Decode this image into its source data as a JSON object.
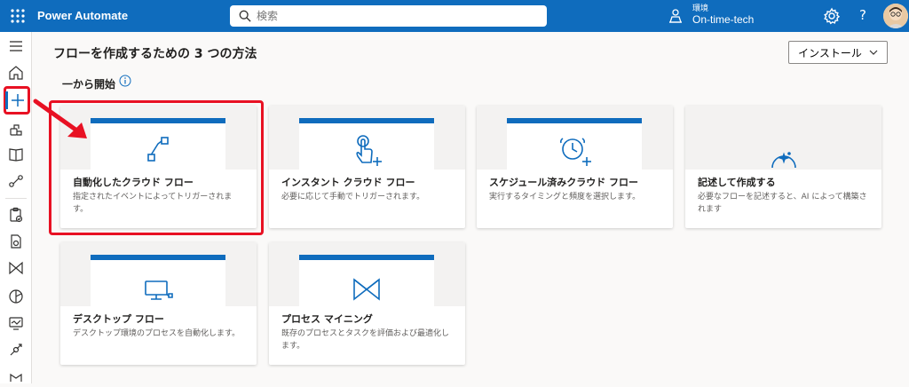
{
  "app": {
    "title": "Power Automate"
  },
  "search": {
    "placeholder": "検索"
  },
  "environment": {
    "label": "環境",
    "value": "On-time-tech"
  },
  "header": {
    "help_label": "?"
  },
  "colors": {
    "brand": "#0f6cbd",
    "highlight": "#e81123"
  },
  "page": {
    "title": "フローを作成するための 3 つの方法",
    "install_label": "インストール",
    "section_title": "一から開始"
  },
  "cards": [
    {
      "title": "自動化したクラウド フロー",
      "desc": "指定されたイベントによってトリガーされます。",
      "icon": "flow-connector-icon"
    },
    {
      "title": "インスタント クラウド フロー",
      "desc": "必要に応じて手動でトリガーされます。",
      "icon": "touch-plus-icon"
    },
    {
      "title": "スケジュール済みクラウド フロー",
      "desc": "実行するタイミングと頻度を選択します。",
      "icon": "alarm-clock-plus-icon"
    },
    {
      "title": "記述して作成する",
      "desc": "必要なフローを記述すると、AI によって構築されます",
      "icon": "chat-sparkle-icon"
    },
    {
      "title": "デスクトップ フロー",
      "desc": "デスクトップ環境のプロセスを自動化します。",
      "icon": "desktop-flow-icon"
    },
    {
      "title": "プロセス マイニング",
      "desc": "既存のプロセスとタスクを評価および最適化します。",
      "icon": "process-mining-icon"
    }
  ]
}
